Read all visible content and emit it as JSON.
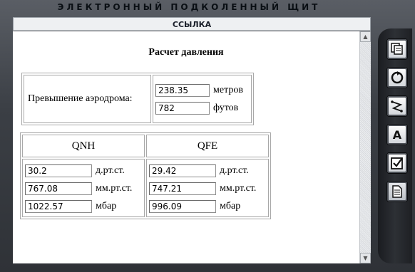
{
  "window": {
    "title": "ЭЛЕКТРОННЫЙ ПОДКОЛЕННЫЙ ЩИТ"
  },
  "tab": {
    "label": "ССЫЛКА"
  },
  "page": {
    "heading": "Расчет давления",
    "elevation": {
      "label": "Превышение аэродрома:",
      "meters_value": "238.35",
      "meters_unit": "метров",
      "feet_value": "782",
      "feet_unit": "футов"
    },
    "qnh": {
      "header": "QNH",
      "inhg_value": "30.2",
      "inhg_unit": "д.рт.ст.",
      "mmhg_value": "767.08",
      "mmhg_unit": "мм.рт.ст.",
      "mbar_value": "1022.57",
      "mbar_unit": "мбар"
    },
    "qfe": {
      "header": "QFE",
      "inhg_value": "29.42",
      "inhg_unit": "д.рт.ст.",
      "mmhg_value": "747.21",
      "mmhg_unit": "мм.рт.ст.",
      "mbar_value": "996.09",
      "mbar_unit": "мбар"
    }
  },
  "sidebar": {
    "buttons": [
      {
        "icon": "copy-pages-icon"
      },
      {
        "icon": "refresh-icon"
      },
      {
        "icon": "route-icon"
      },
      {
        "icon": "font-icon",
        "glyph": "A"
      },
      {
        "icon": "checklist-icon"
      },
      {
        "icon": "document-icon",
        "active": true
      }
    ]
  }
}
